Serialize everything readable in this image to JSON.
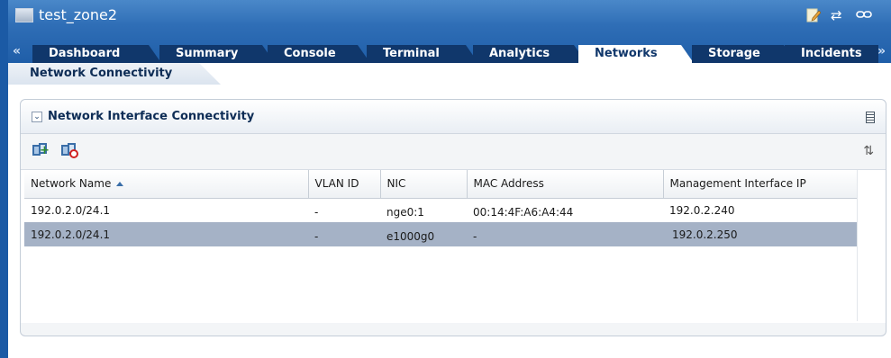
{
  "window": {
    "title": "test_zone2"
  },
  "tabs": [
    {
      "label": "Dashboard",
      "active": false
    },
    {
      "label": "Summary",
      "active": false
    },
    {
      "label": "Console",
      "active": false
    },
    {
      "label": "Terminal",
      "active": false
    },
    {
      "label": "Analytics",
      "active": false
    },
    {
      "label": "Networks",
      "active": true
    },
    {
      "label": "Storage",
      "active": false
    },
    {
      "label": "Incidents",
      "active": false
    }
  ],
  "tab_scroll": {
    "left": "«",
    "right": "»"
  },
  "subtab": {
    "label": "Network Connectivity"
  },
  "panel": {
    "title": "Network Interface Connectivity",
    "collapse_glyph": "⌄"
  },
  "table": {
    "columns": [
      "Network Name",
      "VLAN ID",
      "NIC",
      "MAC Address",
      "Management Interface IP"
    ],
    "sort_column": "Network Name",
    "rows": [
      {
        "network_name": "192.0.2.0/24.1",
        "vlan_id": "-",
        "nic": "nge0:1",
        "mac": "00:14:4F:A6:A4:44",
        "mgmt_ip": "192.0.2.240",
        "selected": false
      },
      {
        "network_name": "192.0.2.0/24.1",
        "vlan_id": "-",
        "nic": "e1000g0",
        "mac": "-",
        "mgmt_ip": "192.0.2.250",
        "selected": true
      }
    ]
  },
  "icons": {
    "titlebar": [
      "edit-notes-icon",
      "swap-arrows-icon",
      "link-icon"
    ],
    "toolbar": [
      "connect-network-icon",
      "disconnect-network-icon",
      "refresh-icon"
    ],
    "glyphs": {
      "swap": "⇄",
      "link": "⊖",
      "refresh": "⇅",
      "plus": "+"
    }
  },
  "colors": {
    "header_blue": "#2f6eb6",
    "tab_dark": "#10376b",
    "selected_row": "#a5b2c6"
  }
}
